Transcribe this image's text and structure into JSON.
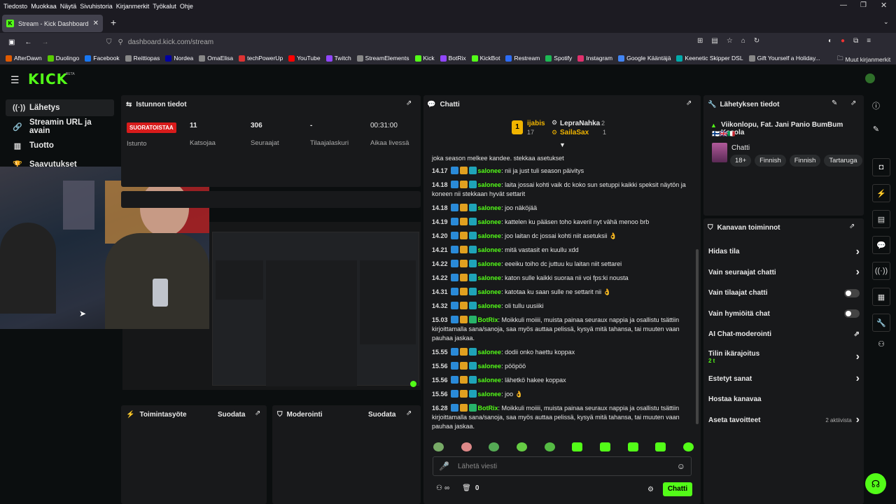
{
  "browser": {
    "menu": [
      "Tiedosto",
      "Muokkaa",
      "Näytä",
      "Sivuhistoria",
      "Kirjanmerkit",
      "Työkalut",
      "Ohje"
    ],
    "tab_title": "Stream - Kick Dashboard",
    "url": "dashboard.kick.com/stream",
    "bookmarks": [
      {
        "label": "AfterDawn",
        "color": "#e05a00"
      },
      {
        "label": "Duolingo",
        "color": "#58cc02"
      },
      {
        "label": "Facebook",
        "color": "#1877f2"
      },
      {
        "label": "Reittiopas",
        "color": "#888"
      },
      {
        "label": "Nordea",
        "color": "#0000a0"
      },
      {
        "label": "OmaElisa",
        "color": "#888"
      },
      {
        "label": "techPowerUp",
        "color": "#d33"
      },
      {
        "label": "YouTube",
        "color": "#f00"
      },
      {
        "label": "Twitch",
        "color": "#9146ff"
      },
      {
        "label": "StreamElements",
        "color": "#888"
      },
      {
        "label": "Kick",
        "color": "#53fc18"
      },
      {
        "label": "BotRix",
        "color": "#9146ff"
      },
      {
        "label": "KickBot",
        "color": "#53fc18"
      },
      {
        "label": "Restream",
        "color": "#2c6cf6"
      },
      {
        "label": "Spotify",
        "color": "#1db954"
      },
      {
        "label": "Instagram",
        "color": "#e1306c"
      },
      {
        "label": "Google Kääntäjä",
        "color": "#4285f4"
      },
      {
        "label": "Keenetic Skipper DSL",
        "color": "#0aa"
      },
      {
        "label": "Gift Yourself a Holiday...",
        "color": "#888"
      }
    ],
    "other_bookmarks": "Muut kirjanmerkit"
  },
  "kick": {
    "logo": "KICK",
    "beta": "BETA",
    "nav": [
      {
        "label": "Lähetys",
        "icon": "broadcast-icon"
      },
      {
        "label": "Streamin URL ja avain",
        "icon": "link-icon"
      },
      {
        "label": "Tuotto",
        "icon": "chart-icon"
      },
      {
        "label": "Saavutukset",
        "icon": "trophy-icon"
      }
    ],
    "session": {
      "title": "Istunnon tiedot",
      "live_badge": "SUORATOISTAA",
      "live_label": "Istunto",
      "viewers": "11",
      "viewers_label": "Katsojaa",
      "followers": "306",
      "followers_label": "Seuraajat",
      "subs": "-",
      "subs_label": "Tilaajalaskuri",
      "time": "00:31:00",
      "time_label": "Aikaa livessä"
    },
    "activity": {
      "title": "Toimintasyöte",
      "filter": "Suodata"
    },
    "moderation": {
      "title": "Moderointi",
      "filter": "Suodata"
    },
    "chat": {
      "title": "Chatti",
      "leaders": [
        {
          "rank": "1",
          "name": "ijabis",
          "count": "17"
        },
        {
          "name": "LepraNahka",
          "count": "2"
        },
        {
          "name": "SailaSax",
          "count": "1"
        }
      ],
      "first_line": "joka season melkee kandee. stekkaa asetukset",
      "messages": [
        {
          "time": "14.17",
          "user": "salonee",
          "text": "nii ja just tuli season päivitys"
        },
        {
          "time": "14.18",
          "user": "salonee",
          "text": "laita jossai kohti vaik dc koko sun setuppi kaikki speksit näytön ja koneen nii stekkaan hyvät settarit"
        },
        {
          "time": "14.18",
          "user": "salonee",
          "text": "joo näköjää"
        },
        {
          "time": "14.19",
          "user": "salonee",
          "text": "kattelen ku pääsen toho kaveril nyt vähä menoo brb"
        },
        {
          "time": "14.20",
          "user": "salonee",
          "text": "joo laitan dc jossai kohti niit asetuksii 👌"
        },
        {
          "time": "14.21",
          "user": "salonee",
          "text": "mitä vastasit en kuullu xdd"
        },
        {
          "time": "14.22",
          "user": "salonee",
          "text": "eeeiku toiho dc juttuu ku laitan niit settarei"
        },
        {
          "time": "14.22",
          "user": "salonee",
          "text": "katon sulle kaikki suoraa nii voi fps:ki nousta"
        },
        {
          "time": "14.31",
          "user": "salonee",
          "text": "katotaa ku saan sulle ne settarit nii 👌"
        },
        {
          "time": "14.32",
          "user": "salonee",
          "text": "oli tullu uusiiki"
        },
        {
          "time": "15.03",
          "user": "BotRix",
          "text": "Moikkuli moiiii, muista painaa seuraux nappia ja osallistu tsättiin kirjoittamalla sana/sanoja, saa myös auttaa pelissä, kysyä mitä tahansa, tai muuten vaan pauhaa jaskaa."
        },
        {
          "time": "15.55",
          "user": "salonee",
          "text": "dodii onko haettu koppax"
        },
        {
          "time": "15.56",
          "user": "salonee",
          "text": "pööpöö"
        },
        {
          "time": "15.56",
          "user": "salonee",
          "text": "lähetkö hakee koppax"
        },
        {
          "time": "15.56",
          "user": "salonee",
          "text": "joo 👌"
        },
        {
          "time": "16.28",
          "user": "BotRix",
          "text": "Moikkuli moiiii, muista painaa seuraux nappia ja osallistu tsättiin kirjoittamalla sana/sanoja, saa myös auttaa pelissä, kysyä mitä tahansa, tai muuten vaan pauhaa jaskaa."
        }
      ],
      "placeholder": "Lähetä viesti",
      "viewer_count": "0",
      "send": "Chatti"
    },
    "stream_info": {
      "title": "Lähetyksen tiedot",
      "stream_title": "Viikonlopu, Fat. Jani Panio BumBum Kosola",
      "flags": "🇫🇮🇬🇧🇮🇹",
      "category": "Chatti",
      "tags": [
        "18+",
        "Finnish",
        "Finnish",
        "Tartaruga"
      ]
    },
    "channel": {
      "title": "Kanavan toiminnot",
      "items": [
        {
          "label": "Hidas tila",
          "kind": "arrow"
        },
        {
          "label": "Vain seuraajat chatti",
          "kind": "arrow"
        },
        {
          "label": "Vain tilaajat chatti",
          "kind": "toggle"
        },
        {
          "label": "Vain hymiöitä chat",
          "kind": "toggle"
        },
        {
          "label": "AI Chat-moderointi",
          "kind": "ext"
        },
        {
          "label": "Tilin ikärajoitus",
          "kind": "arrow",
          "sub": "2 t"
        },
        {
          "label": "Estetyt sanat",
          "kind": "arrow"
        },
        {
          "label": "Hostaa kanavaa",
          "kind": "none"
        },
        {
          "label": "Aseta tavoitteet",
          "kind": "arrow",
          "extra": "2 aktiivista"
        }
      ]
    }
  },
  "colors": {
    "accent": "#53fc18",
    "live": "#d81b1b",
    "panel": "#18191b"
  }
}
